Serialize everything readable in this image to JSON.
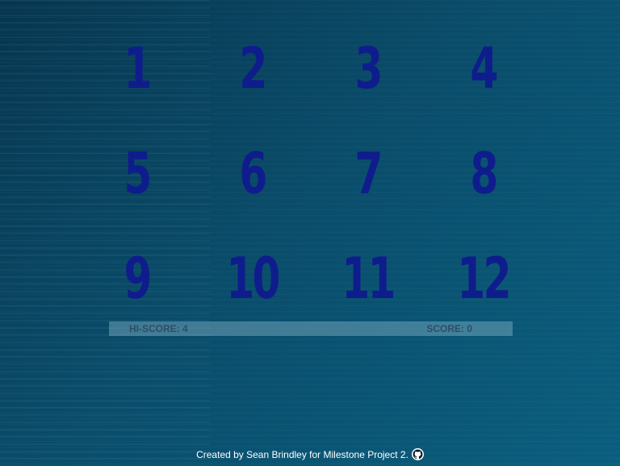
{
  "tiles": [
    "1",
    "2",
    "3",
    "4",
    "5",
    "6",
    "7",
    "8",
    "9",
    "10",
    "11",
    "12"
  ],
  "scoreboard": {
    "hi_score": "HI-SCORE: 4",
    "score": "SCORE: 0"
  },
  "footer": {
    "credit": "Created by Sean Brindley for Milestone Project 2.",
    "icon": "github-icon"
  },
  "colors": {
    "tile_text": "#0f1d8c",
    "background": "#0a4d6b",
    "score_text": "#2e4d66"
  }
}
